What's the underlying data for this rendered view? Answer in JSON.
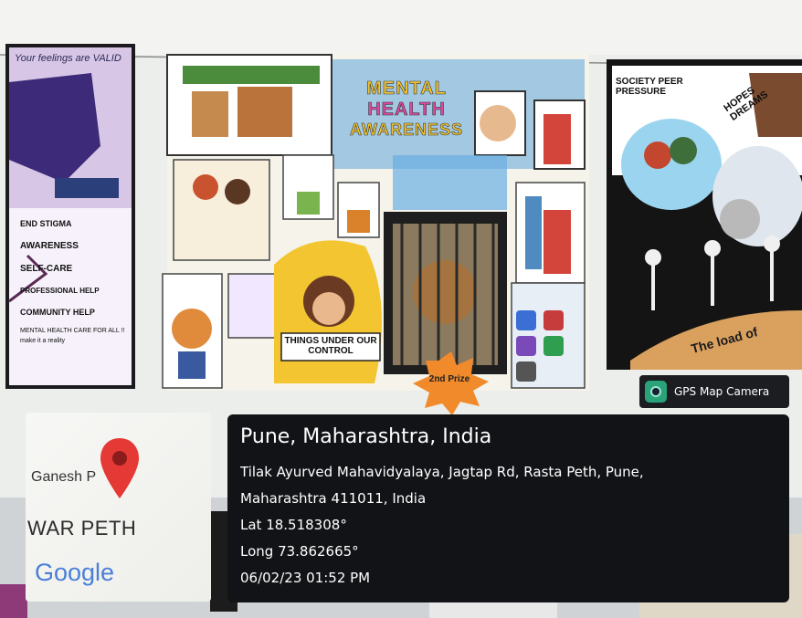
{
  "posters": {
    "left": {
      "header": "Your feelings are VALID",
      "items": [
        "END STIGMA",
        "AWARENESS",
        "SELF-CARE",
        "PROFESSIONAL HELP",
        "COMMUNITY HELP",
        "MENTAL HEALTH CARE FOR ALL !!",
        "make it a reality"
      ]
    },
    "center": {
      "title_lines": [
        "MENTAL",
        "HEALTH",
        "AWARENESS"
      ],
      "caption": "THINGS UNDER OUR CONTROL",
      "prize": "2nd Prize"
    },
    "right": {
      "top_left": "SOCIETY PEER PRESSURE",
      "top_right": "HOPES DREAMS",
      "bottom": "The load of"
    }
  },
  "gps_badge": {
    "label": "GPS Map Camera",
    "icon": "camera-app-icon"
  },
  "map": {
    "label_top": "Ganesh P",
    "label_area": "WAR PETH",
    "brand": "Google",
    "pin_icon": "map-pin-icon",
    "pin_color": "#e53935"
  },
  "location": {
    "city": "Pune, Maharashtra, India",
    "address_line1": "Tilak Ayurved Mahavidyalaya, Jagtap Rd, Rasta Peth, Pune,",
    "address_line2": "Maharashtra 411011, India",
    "lat": "Lat 18.518308°",
    "long": "Long 73.862665°",
    "datetime": "06/02/23 01:52 PM"
  }
}
